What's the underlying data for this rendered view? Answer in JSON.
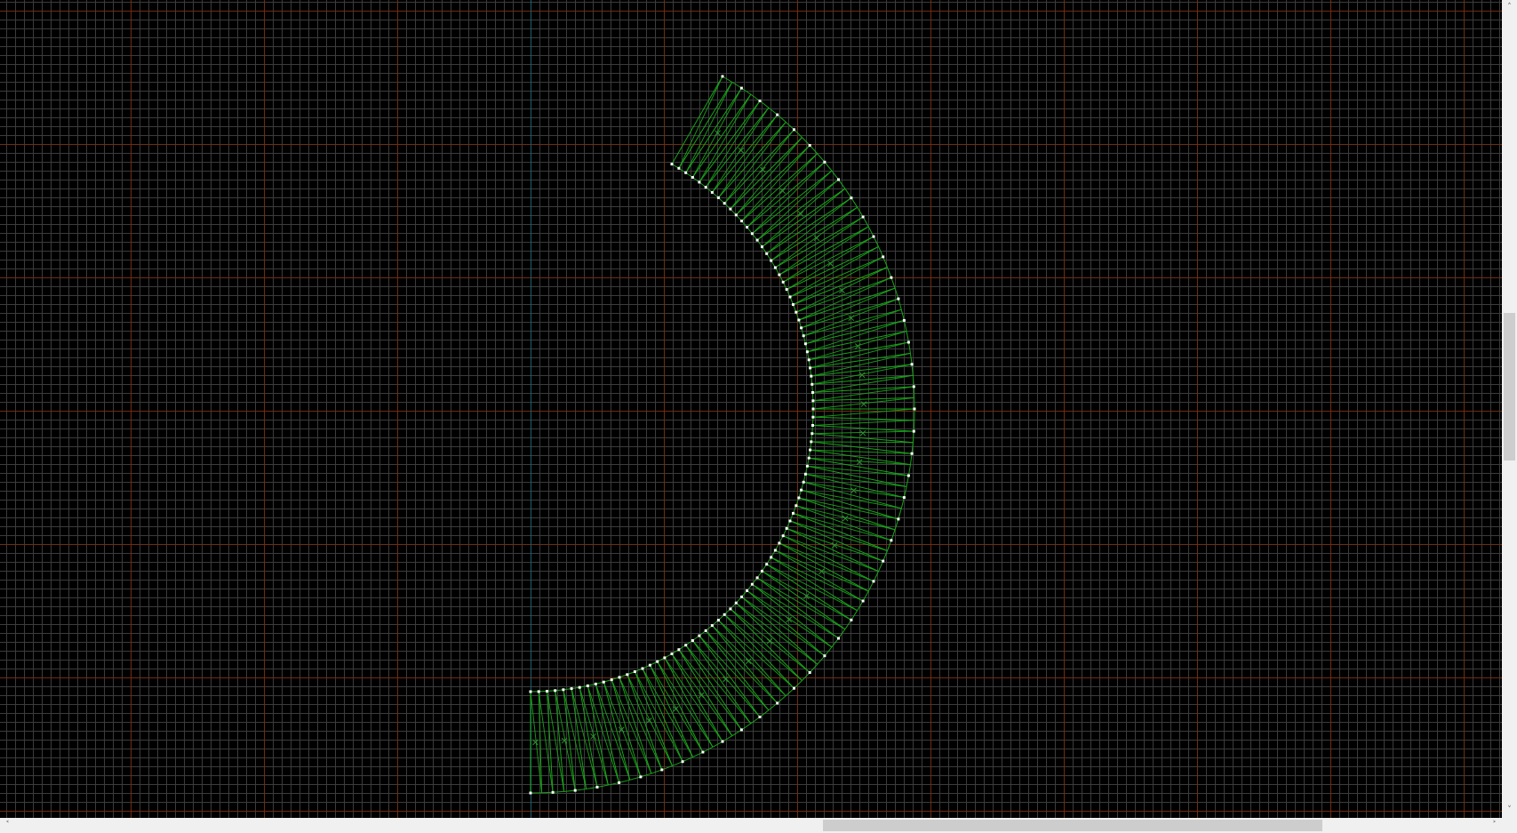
{
  "canvas": {
    "background": "#000000",
    "minor_grid_color": "#3c3c3c",
    "major_grid_color": "#6e2d12",
    "axis_color": "#1f5f6a",
    "track_fill_color": "#19a519",
    "track_center_mark_color": "#2f8f2f",
    "track_node_color": "#ffffff",
    "element_count": 90,
    "arc_sweep_degrees": 150
  },
  "scrollbars": {
    "vertical": {
      "up_icon": "chevron-up-icon",
      "down_icon": "chevron-down-icon",
      "up_glyph": "˄",
      "down_glyph": "˅",
      "position": 0.44
    },
    "horizontal": {
      "left_icon": "chevron-left-icon",
      "right_icon": "chevron-right-icon",
      "left_glyph": "˂",
      "right_glyph": "˃",
      "position": 0.62
    }
  }
}
